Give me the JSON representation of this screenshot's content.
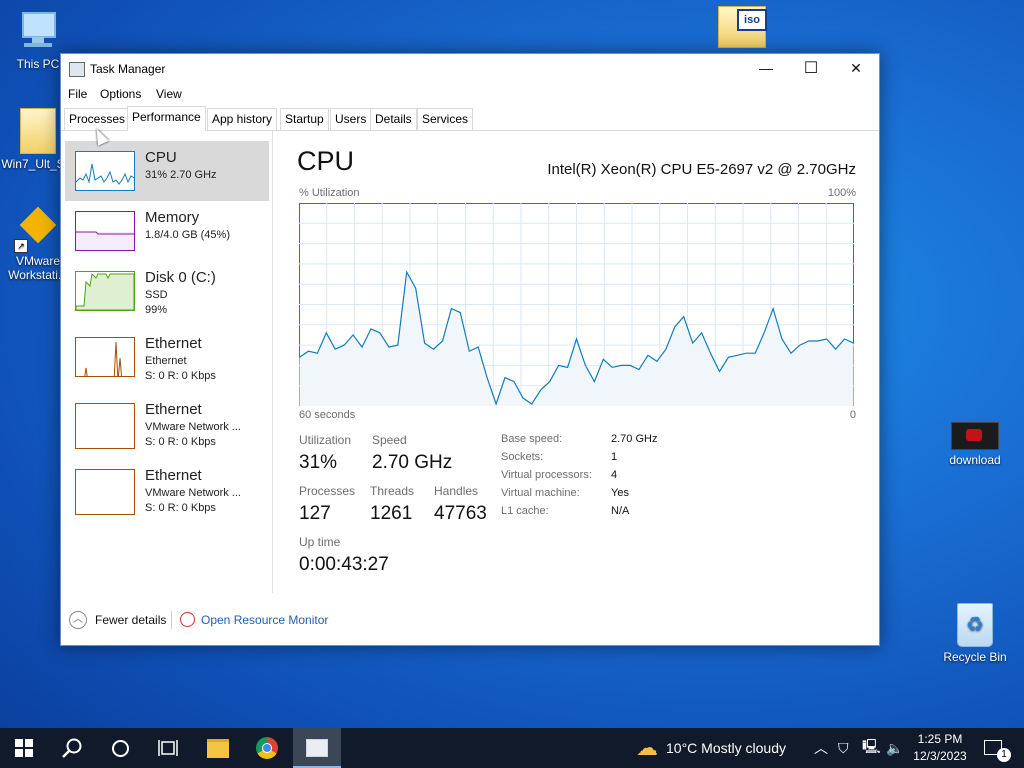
{
  "desktop": {
    "icons": [
      {
        "label": "This PC"
      },
      {
        "label": "Win7_Ult_S..."
      },
      {
        "label": "VMware Workstati..."
      },
      {
        "label": "download"
      },
      {
        "label": "Recycle Bin"
      }
    ]
  },
  "window": {
    "title": "Task Manager",
    "controls": {
      "minimize": "—",
      "maximize": "☐",
      "close": "✕"
    }
  },
  "menu": [
    "File",
    "Options",
    "View"
  ],
  "tabs": [
    "Processes",
    "Performance",
    "App history",
    "Startup",
    "Users",
    "Details",
    "Services"
  ],
  "active_tab": "Performance",
  "sidebar": {
    "items": [
      {
        "name": "CPU",
        "line2": "31%  2.70 GHz",
        "line3": "",
        "color": "#117dbb"
      },
      {
        "name": "Memory",
        "line2": "1.8/4.0 GB (45%)",
        "line3": "",
        "color": "#8b12ae"
      },
      {
        "name": "Disk 0 (C:)",
        "line2": "SSD",
        "line3": "99%",
        "color": "#4da60c"
      },
      {
        "name": "Ethernet",
        "line2": "Ethernet",
        "line3": "S: 0  R: 0 Kbps",
        "color": "#a74f01"
      },
      {
        "name": "Ethernet",
        "line2": "VMware Network ...",
        "line3": "S: 0  R: 0 Kbps",
        "color": "#a74f01"
      },
      {
        "name": "Ethernet",
        "line2": "VMware Network ...",
        "line3": "S: 0  R: 0 Kbps",
        "color": "#a74f01"
      }
    ]
  },
  "main": {
    "title": "CPU",
    "cpu_model": "Intel(R) Xeon(R) CPU E5-2697 v2 @ 2.70GHz",
    "graph": {
      "y_label": "% Utilization",
      "y_max_label": "100%",
      "x_left_label": "60 seconds",
      "x_right_label": "0",
      "line_color": "#117dbb",
      "fill_color": "#f1f6fa",
      "samples": [
        24,
        27,
        26,
        36,
        28,
        30,
        35,
        29,
        38,
        36,
        29,
        30,
        66,
        58,
        31,
        28,
        32,
        48,
        46,
        27,
        29,
        14,
        1,
        14,
        12,
        4,
        1,
        8,
        12,
        20,
        19,
        33,
        20,
        12,
        23,
        19,
        20,
        20,
        18,
        25,
        22,
        28,
        39,
        44,
        31,
        36,
        26,
        17,
        24,
        25,
        26,
        26,
        36,
        48,
        33,
        26,
        30,
        32,
        32,
        33,
        28,
        33,
        31
      ]
    },
    "stats": [
      {
        "label": "Utilization",
        "value": "31%"
      },
      {
        "label": "Speed",
        "value": "2.70 GHz"
      },
      {
        "label": "Processes",
        "value": "127"
      },
      {
        "label": "Threads",
        "value": "1261"
      },
      {
        "label": "Handles",
        "value": "47763"
      },
      {
        "label": "Up time",
        "value": "0:00:43:27"
      }
    ],
    "details": [
      {
        "key": "Base speed:",
        "value": "2.70 GHz"
      },
      {
        "key": "Sockets:",
        "value": "1"
      },
      {
        "key": "Virtual processors:",
        "value": "4"
      },
      {
        "key": "Virtual machine:",
        "value": "Yes"
      },
      {
        "key": "L1 cache:",
        "value": "N/A"
      }
    ]
  },
  "footer": {
    "fewer_details": "Fewer details",
    "open_resource_monitor": "Open Resource Monitor"
  },
  "taskbar": {
    "weather": "10°C   Mostly cloudy",
    "time": "1:25 PM",
    "date": "12/3/2023",
    "notification_count": "1"
  }
}
